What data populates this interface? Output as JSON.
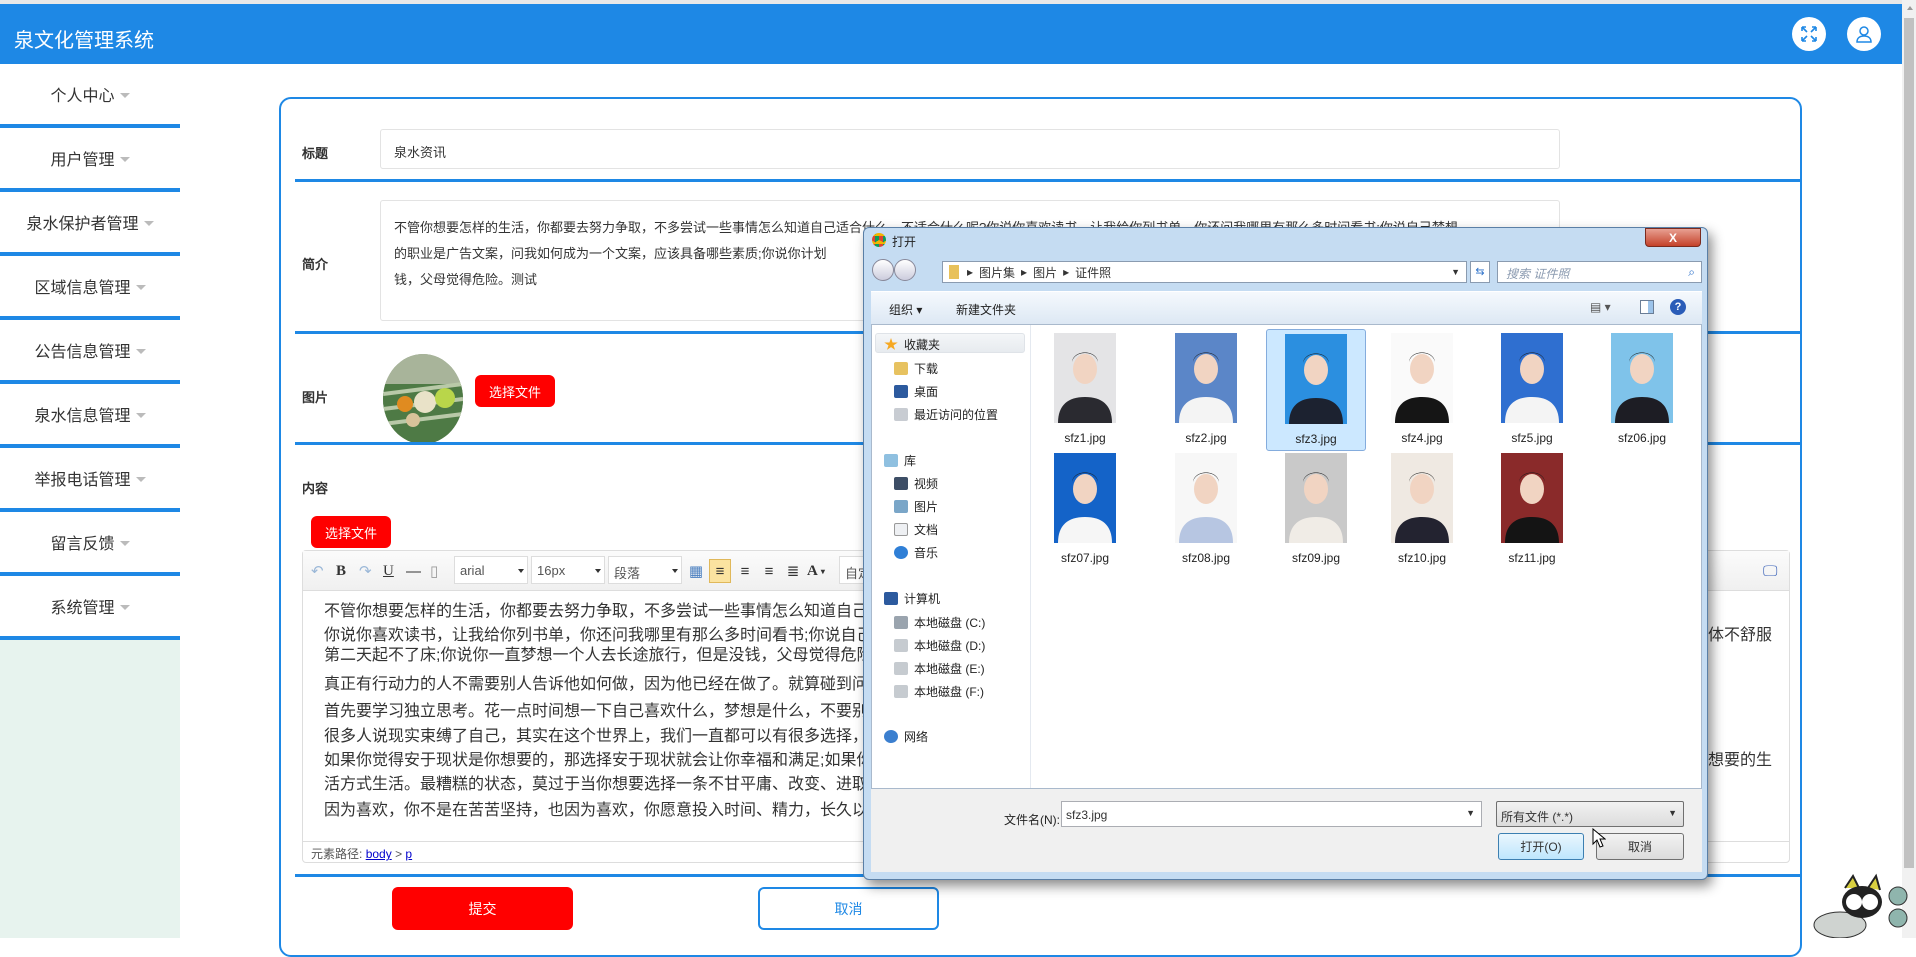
{
  "header": {
    "title": "泉文化管理系统",
    "fullscreen_icon": "expand-icon",
    "user_icon": "user-icon",
    "color": "#1e88e5"
  },
  "sidebar": {
    "items": [
      {
        "label": "个人中心"
      },
      {
        "label": "用户管理"
      },
      {
        "label": "泉水保护者管理"
      },
      {
        "label": "区域信息管理"
      },
      {
        "label": "公告信息管理"
      },
      {
        "label": "泉水信息管理"
      },
      {
        "label": "举报电话管理"
      },
      {
        "label": "留言反馈"
      },
      {
        "label": "系统管理"
      }
    ]
  },
  "form": {
    "title_label": "标题",
    "title_value": "泉水资讯",
    "intro_label": "简介",
    "intro_lines": [
      "不管你想要怎样的生活，你都要去努力争取，不多尝试一些事情怎么知道自己适合什么，不适合什么呢?你说你喜欢读书，让我给你列书单，你还问我哪里有那么多时间看书;你说自己梦想",
      "的职业是广告文案，问我如何成为一个文案，应该具备哪些素质;你说你计划",
      "钱，父母觉得危险。测试"
    ],
    "image_label": "图片",
    "choose_file": "选择文件",
    "content_label": "内容",
    "content_choose_file": "选择文件",
    "submit": "提交",
    "cancel": "取消"
  },
  "editor": {
    "font": "arial",
    "size": "16px",
    "paragraph": "段落",
    "custom": "自定",
    "bold": "B",
    "underline": "U",
    "font_color": "A",
    "lines": [
      {
        "left": "不管你想要怎样的生活，你都要去努力争取，不多尝试一些事情怎么知道自己适",
        "right": ""
      },
      {
        "left": "你说你喜欢读书，让我给你列书单，你还问我哪里有那么多时间看书;你说自己梦",
        "right": "体不舒服"
      },
      {
        "left": "第二天起不了床;你说你一直梦想一个人去长途旅行，但是没钱，父母觉得危险。",
        "right": ""
      },
      {
        "left": "真正有行动力的人不需要别人告诉他如何做，因为他已经在做了。就算碰到问题",
        "right": ""
      },
      {
        "left": "首先要学习独立思考。花一点时间想一下自己喜欢什么，梦想是什么，不要别人",
        "right": ""
      },
      {
        "left": "很多人说现实束缚了自己，其实在这个世界上，我们一直都可以有很多选择，生",
        "right": ""
      },
      {
        "left": "如果你觉得安于现状是你想要的，那选择安于现状就会让你幸福和满足;如果你不",
        "right": "想要的生"
      },
      {
        "left": "活方式生活。最糟糕的状态，莫过于当你想要选择一条不甘平庸、改变、进取和",
        "right": ""
      },
      {
        "left": "因为喜欢，你不是在苦苦坚持，也因为喜欢，你愿意投入时间、精力，长久以往",
        "right": ""
      }
    ],
    "path_label": "元素路径:",
    "path_body": "body",
    "path_sep": ">",
    "path_p": "p"
  },
  "dialog": {
    "title": "打开",
    "close": "X",
    "breadcrumb": [
      "图片集",
      "图片",
      "证件照"
    ],
    "search_placeholder": "搜索 证件照",
    "organize": "组织 ▾",
    "new_folder": "新建文件夹",
    "nav": {
      "favorites": "收藏夹",
      "fav_items": [
        "下载",
        "桌面",
        "最近访问的位置"
      ],
      "library": "库",
      "lib_items": [
        "视频",
        "图片",
        "文档",
        "音乐"
      ],
      "computer": "计算机",
      "drives": [
        "本地磁盘 (C:)",
        "本地磁盘 (D:)",
        "本地磁盘 (E:)",
        "本地磁盘 (F:)"
      ],
      "network": "网络"
    },
    "files": [
      {
        "name": "sfz1.jpg",
        "bg": "#e4e4e6",
        "cloth": "#2a2a30",
        "selected": false
      },
      {
        "name": "sfz2.jpg",
        "bg": "#5b86c8",
        "cloth": "#f4f4f4",
        "selected": false
      },
      {
        "name": "sfz3.jpg",
        "bg": "#2b8fe0",
        "cloth": "#1c2230",
        "selected": true
      },
      {
        "name": "sfz4.jpg",
        "bg": "#fafafa",
        "cloth": "#151515",
        "selected": false
      },
      {
        "name": "sfz5.jpg",
        "bg": "#2f6fd0",
        "cloth": "#f4f4f4",
        "selected": false
      },
      {
        "name": "sfz06.jpg",
        "bg": "#7fc3ea",
        "cloth": "#1d1d24",
        "selected": false
      },
      {
        "name": "sfz07.jpg",
        "bg": "#1463c8",
        "cloth": "#f6f6f6",
        "selected": false
      },
      {
        "name": "sfz08.jpg",
        "bg": "#f7f7f7",
        "cloth": "#b7c6e2",
        "selected": false
      },
      {
        "name": "sfz09.jpg",
        "bg": "#c9c9c9",
        "cloth": "#f0ece6",
        "selected": false
      },
      {
        "name": "sfz10.jpg",
        "bg": "#efe9e2",
        "cloth": "#232330",
        "selected": false
      },
      {
        "name": "sfz11.jpg",
        "bg": "#8a2a2a",
        "cloth": "#141414",
        "selected": false
      }
    ],
    "filename_label": "文件名(N):",
    "filename_value": "sfz3.jpg",
    "filetype": "所有文件 (*.*)",
    "open": "打开(O)",
    "cancel": "取消"
  }
}
